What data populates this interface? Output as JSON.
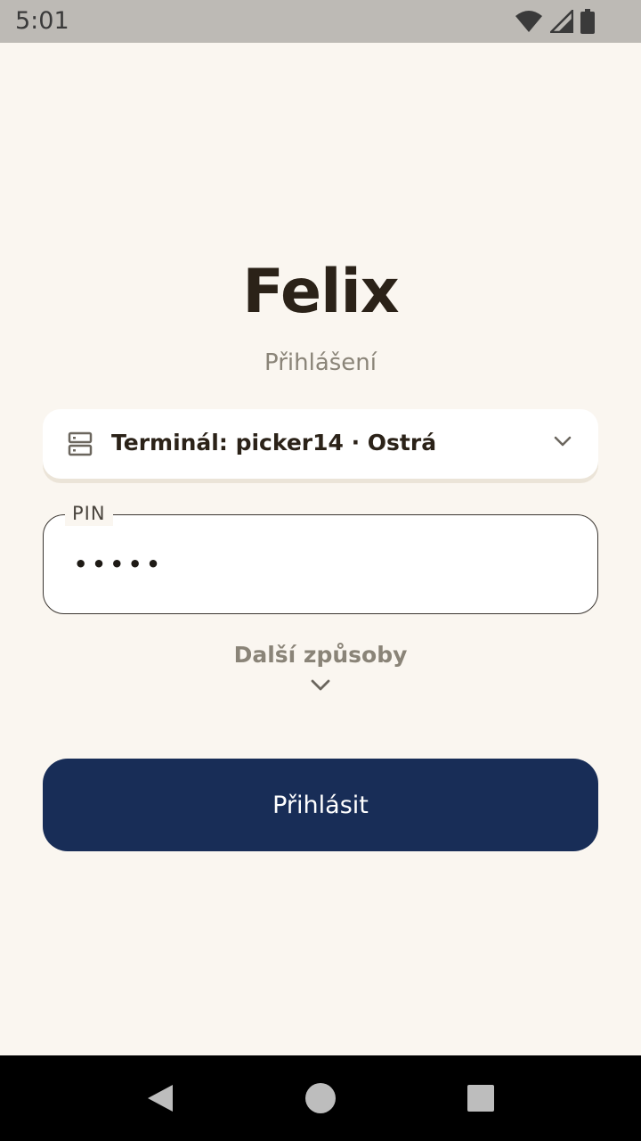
{
  "status_bar": {
    "time": "5:01",
    "icons": [
      "wifi-icon",
      "cellular-signal-icon",
      "battery-icon"
    ]
  },
  "app": {
    "title": "Felix",
    "subtitle": "Přihlášení"
  },
  "terminal_select": {
    "icon": "server-icon",
    "label": "Terminál: picker14 · Ostrá",
    "chevron": "chevron-down-icon"
  },
  "pin_field": {
    "label": "PIN",
    "value": "•••••"
  },
  "more_methods": {
    "label": "Další způsoby",
    "chevron": "chevron-down-icon"
  },
  "login_button": {
    "label": "Přihlásit"
  },
  "nav_bar": {
    "buttons": [
      "back-icon",
      "home-icon",
      "recents-icon"
    ]
  },
  "colors": {
    "background": "#faf6f0",
    "primary": "#182d57",
    "title": "#2b2218",
    "muted": "#8a8478",
    "status_bar": "#bdbab5"
  }
}
